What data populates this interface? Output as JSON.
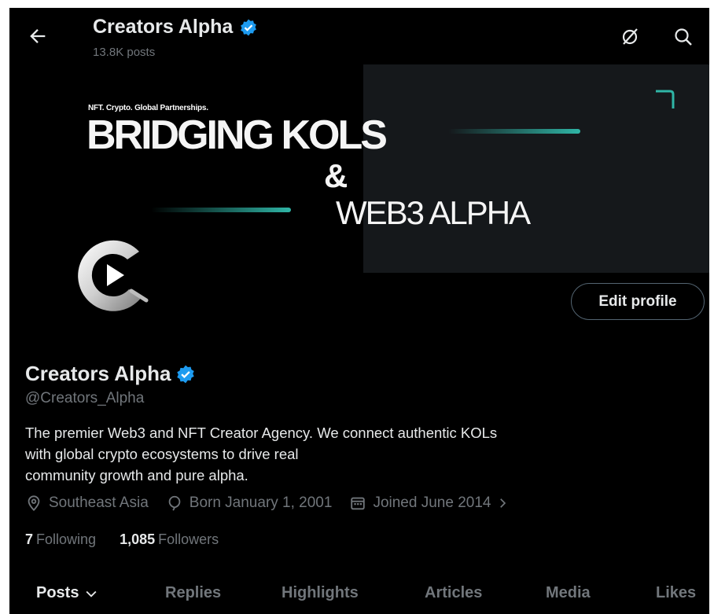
{
  "header": {
    "back_icon": "arrow-left-icon",
    "title": "Creators Alpha",
    "posts_count": "13.8K posts",
    "grok_icon": "grok-icon",
    "search_icon": "search-icon"
  },
  "banner": {
    "tagline": "NFT. Crypto. Global Partnerships.",
    "headline_1": "BRIDGING KOLS",
    "headline_amp": "&",
    "headline_2": "WEB3 ALPHA",
    "accent_color": "#2fb5a6"
  },
  "profile": {
    "name": "Creators Alpha",
    "handle": "@Creators_Alpha",
    "edit_label": "Edit profile",
    "bio_lines": [
      "The premier Web3 and NFT Creator Agency. We connect authentic KOLs",
      "with global crypto ecosystems to drive real",
      "community growth and pure alpha."
    ],
    "location": "Southeast Asia",
    "birthday": "Born January 1, 2001",
    "joined": "Joined June 2014",
    "following_count": "7",
    "following_label": "Following",
    "followers_count": "1,085",
    "followers_label": "Followers",
    "verified_color": "#1d9bf0"
  },
  "tabs": [
    "Posts",
    "Replies",
    "Highlights",
    "Articles",
    "Media",
    "Likes"
  ]
}
